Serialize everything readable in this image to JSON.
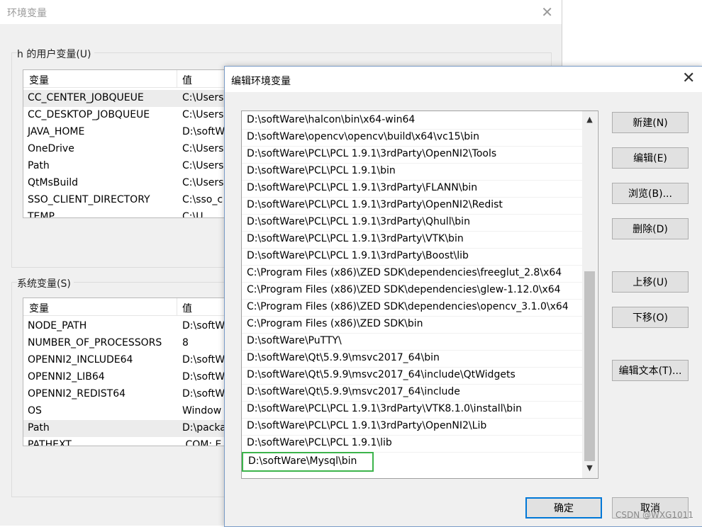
{
  "bg_window": {
    "title": "环境变量",
    "user_group_label": "h 的用户变量(U)",
    "system_group_label": "系统变量(S)",
    "col_var": "变量",
    "col_val": "值",
    "user_vars": [
      {
        "name": "CC_CENTER_JOBQUEUE",
        "value": "C:\\Users"
      },
      {
        "name": "CC_DESKTOP_JOBQUEUE",
        "value": "C:\\Users"
      },
      {
        "name": "JAVA_HOME",
        "value": "D:\\softW"
      },
      {
        "name": "OneDrive",
        "value": "C:\\Users"
      },
      {
        "name": "Path",
        "value": "C:\\Users"
      },
      {
        "name": "QtMsBuild",
        "value": "C:\\Users"
      },
      {
        "name": "SSO_CLIENT_DIRECTORY",
        "value": "C:\\sso_c"
      },
      {
        "name": "TEMP",
        "value": "C:\\U"
      }
    ],
    "system_vars": [
      {
        "name": "NODE_PATH",
        "value": "D:\\softW"
      },
      {
        "name": "NUMBER_OF_PROCESSORS",
        "value": "8"
      },
      {
        "name": "OPENNI2_INCLUDE64",
        "value": "D:\\softW"
      },
      {
        "name": "OPENNI2_LIB64",
        "value": "D:\\softW"
      },
      {
        "name": "OPENNI2_REDIST64",
        "value": "D:\\softW"
      },
      {
        "name": "OS",
        "value": "Window"
      },
      {
        "name": "Path",
        "value": "D:\\packa"
      },
      {
        "name": "PATHEXT",
        "value": ".COM;.E"
      }
    ]
  },
  "dialog": {
    "title": "编辑环境变量",
    "paths": [
      "D:\\softWare\\halcon\\bin\\x64-win64",
      "D:\\softWare\\opencv\\opencv\\build\\x64\\vc15\\bin",
      "D:\\softWare\\PCL\\PCL 1.9.1\\3rdParty\\OpenNI2\\Tools",
      "D:\\softWare\\PCL\\PCL 1.9.1\\bin",
      "D:\\softWare\\PCL\\PCL 1.9.1\\3rdParty\\FLANN\\bin",
      "D:\\softWare\\PCL\\PCL 1.9.1\\3rdParty\\OpenNI2\\Redist",
      "D:\\softWare\\PCL\\PCL 1.9.1\\3rdParty\\Qhull\\bin",
      "D:\\softWare\\PCL\\PCL 1.9.1\\3rdParty\\VTK\\bin",
      "D:\\softWare\\PCL\\PCL 1.9.1\\3rdParty\\Boost\\lib",
      "C:\\Program Files (x86)\\ZED SDK\\dependencies\\freeglut_2.8\\x64",
      "C:\\Program Files (x86)\\ZED SDK\\dependencies\\glew-1.12.0\\x64",
      "C:\\Program Files (x86)\\ZED SDK\\dependencies\\opencv_3.1.0\\x64",
      "C:\\Program Files (x86)\\ZED SDK\\bin",
      "D:\\softWare\\PuTTY\\",
      "D:\\softWare\\Qt\\5.9.9\\msvc2017_64\\bin",
      "D:\\softWare\\Qt\\5.9.9\\msvc2017_64\\include\\QtWidgets",
      "D:\\softWare\\Qt\\5.9.9\\msvc2017_64\\include",
      "D:\\softWare\\PCL\\PCL 1.9.1\\3rdParty\\VTK8.1.0\\install\\bin",
      "D:\\softWare\\PCL\\PCL 1.9.1\\3rdParty\\OpenNI2\\Lib",
      "D:\\softWare\\PCL\\PCL 1.9.1\\lib",
      "D:\\softWare\\Mysql\\bin"
    ],
    "buttons": {
      "new": "新建(N)",
      "edit": "编辑(E)",
      "browse": "浏览(B)...",
      "delete": "删除(D)",
      "move_up": "上移(U)",
      "move_down": "下移(O)",
      "edit_text": "编辑文本(T)...",
      "ok": "确定",
      "cancel": "取消"
    },
    "active_highlight_color": "#3cb44b"
  },
  "watermark": "CSDN @WXG1011"
}
